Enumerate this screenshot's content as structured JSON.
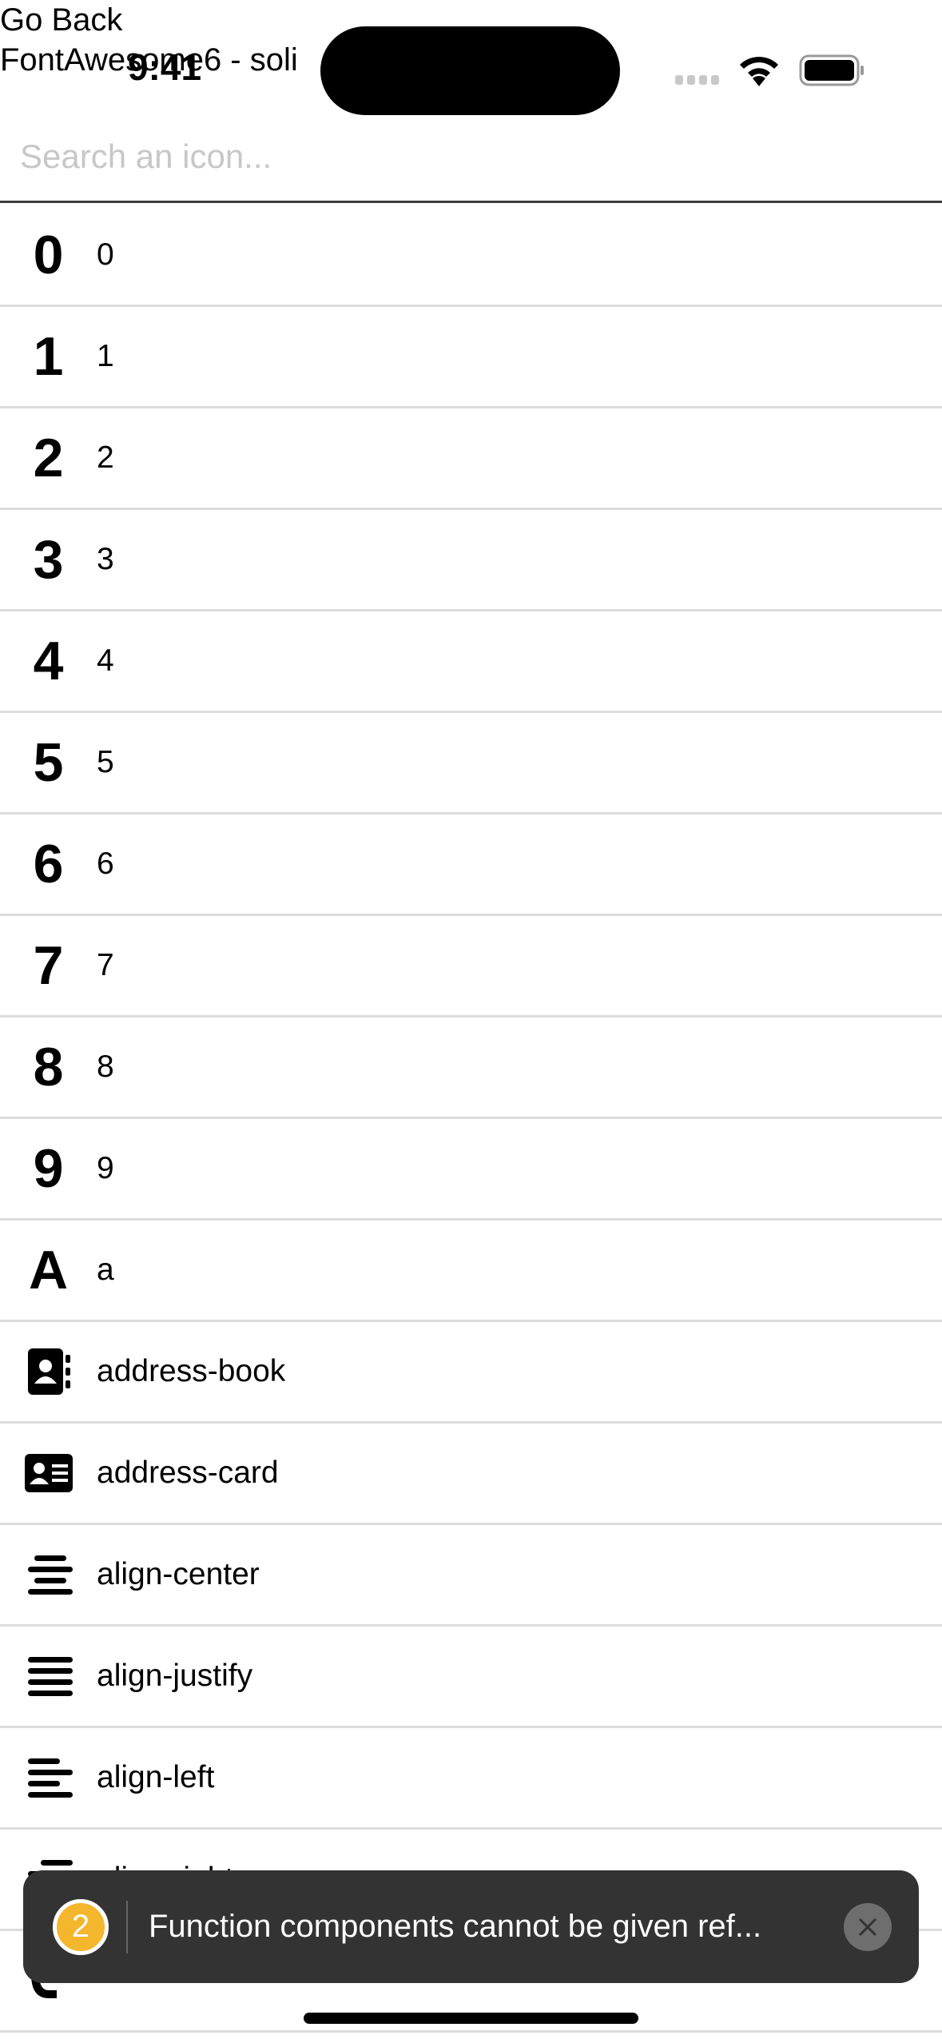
{
  "header": {
    "back_label": "Go Back",
    "title": "FontAwesome6 - soli"
  },
  "status_bar": {
    "time": "9:41",
    "wifi_icon": "wifi-icon",
    "battery_icon": "battery-full-icon"
  },
  "search": {
    "placeholder": "Search an icon...",
    "value": ""
  },
  "icons": [
    {
      "glyph": "0",
      "label": "0"
    },
    {
      "glyph": "1",
      "label": "1"
    },
    {
      "glyph": "2",
      "label": "2"
    },
    {
      "glyph": "3",
      "label": "3"
    },
    {
      "glyph": "4",
      "label": "4"
    },
    {
      "glyph": "5",
      "label": "5"
    },
    {
      "glyph": "6",
      "label": "6"
    },
    {
      "glyph": "7",
      "label": "7"
    },
    {
      "glyph": "8",
      "label": "8"
    },
    {
      "glyph": "9",
      "label": "9"
    },
    {
      "glyph": "A",
      "label": "a"
    },
    {
      "icon": "address-book-icon",
      "label": "address-book"
    },
    {
      "icon": "address-card-icon",
      "label": "address-card"
    },
    {
      "icon": "align-center-icon",
      "label": "align-center"
    },
    {
      "icon": "align-justify-icon",
      "label": "align-justify"
    },
    {
      "icon": "align-left-icon",
      "label": "align-left"
    },
    {
      "icon": "align-right-icon",
      "label": "align-right"
    }
  ],
  "toast": {
    "count": "2",
    "message": "Function components cannot be given ref...",
    "badge_color": "#f4b62c"
  }
}
